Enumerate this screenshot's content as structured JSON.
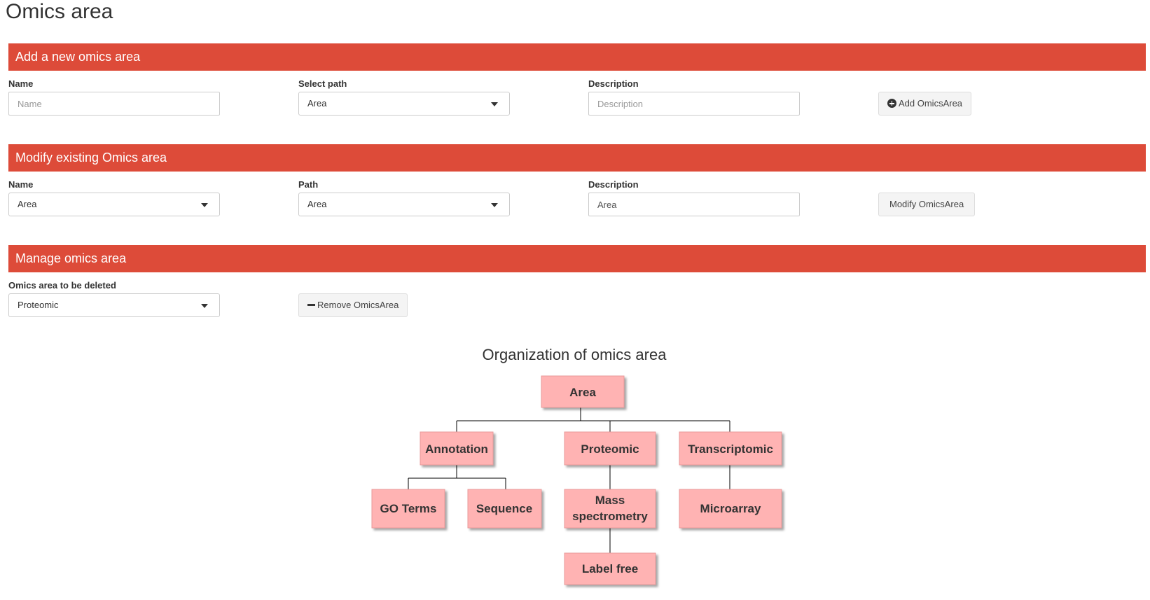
{
  "page": {
    "title": "Omics area"
  },
  "add_section": {
    "title": "Add a new omics area",
    "name_label": "Name",
    "name_placeholder": "Name",
    "path_label": "Select path",
    "path_value": "Area",
    "description_label": "Description",
    "description_placeholder": "Description",
    "add_button": "Add OmicsArea",
    "add_button_icon": "plus-circle-icon"
  },
  "modify_section": {
    "title": "Modify existing Omics area",
    "name_label": "Name",
    "name_value": "Area",
    "path_label": "Path",
    "path_value": "Area",
    "description_label": "Description",
    "description_value": "Area",
    "modify_button": "Modify OmicsArea"
  },
  "manage_section": {
    "title": "Manage omics area",
    "delete_label": "Omics area to be deleted",
    "delete_value": "Proteomic",
    "remove_button": "Remove OmicsArea",
    "remove_button_icon": "minus-icon"
  },
  "tree": {
    "title": "Organization of omics area",
    "node_color": "#ffb3b3",
    "root": "Area",
    "level1": [
      "Annotation",
      "Proteomic",
      "Transcriptomic"
    ],
    "annotation_children": [
      "GO Terms",
      "Sequence"
    ],
    "proteomic_child": [
      "Mass",
      "spectrometry"
    ],
    "mass_spec_child": "Label free",
    "transcriptomic_child": "Microarray"
  },
  "colors": {
    "header_bar": "#dd4b39",
    "button_bg": "#f4f4f4"
  }
}
